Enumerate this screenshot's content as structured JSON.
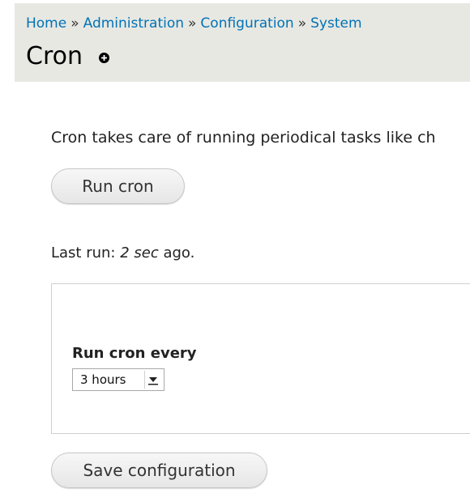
{
  "breadcrumb": {
    "items": [
      "Home",
      "Administration",
      "Configuration",
      "System"
    ],
    "separator": "»"
  },
  "page": {
    "title": "Cron",
    "title_icon": "plus-circle-icon"
  },
  "main": {
    "description": "Cron takes care of running periodical tasks like ch",
    "run_button_label": "Run cron",
    "last_run_prefix": "Last run: ",
    "last_run_value": "2 sec",
    "last_run_suffix": " ago.",
    "frequency": {
      "label": "Run cron every",
      "selected": "3 hours",
      "icon": "dropdown-arrow-icon"
    },
    "save_button_label": "Save configuration"
  },
  "colors": {
    "link": "#0073b6",
    "header_bg": "#e8e8e3"
  }
}
